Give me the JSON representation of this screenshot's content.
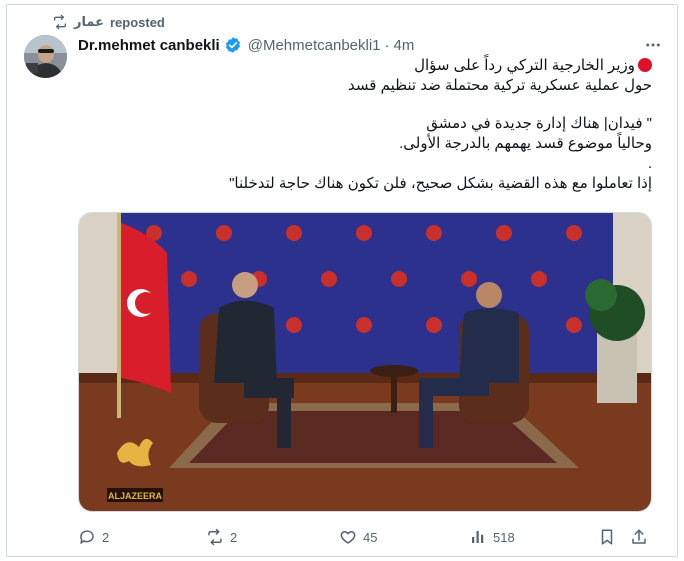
{
  "repost": {
    "user": "عمار",
    "label": "reposted",
    "icon": "repost-icon"
  },
  "author": {
    "name": "Dr.mehmet canbekli",
    "handle": "@Mehmetcanbekli1",
    "separator": "·",
    "time": "4m",
    "verified_color": "#1d9bf0"
  },
  "tweet": {
    "lines": [
      "وزير الخارجية التركي رداً على سؤال",
      "حول عملية عسكرية تركية محتملة ضد تنظيم قسد",
      "\" فيدان| هناك إدارة جديدة في دمشق",
      "وحالياً موضوع قسد يهمهم بالدرجة الأولى.",
      ".",
      "إذا تعاملوا مع هذه القضية بشكل صحيح، فلن تكون هناك حاجة لتدخلنا\""
    ]
  },
  "media": {
    "watermark": "ALJAZEERA",
    "accent": "#2a2f8f"
  },
  "actions": {
    "reply_count": "2",
    "repost_count": "2",
    "like_count": "45",
    "views_count": "518"
  }
}
